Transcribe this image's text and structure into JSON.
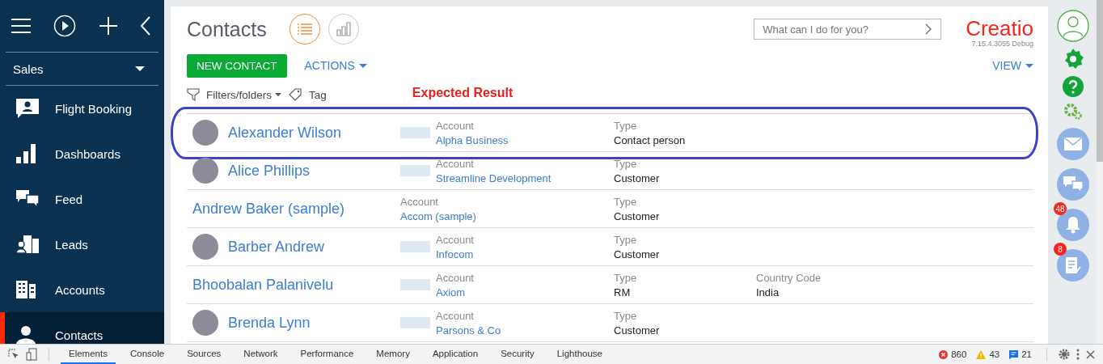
{
  "sidebar": {
    "section": "Sales",
    "items": [
      {
        "label": "Flight Booking",
        "kind": "booking",
        "selected": false
      },
      {
        "label": "Dashboards",
        "kind": "chart",
        "selected": false
      },
      {
        "label": "Feed",
        "kind": "feed",
        "selected": false
      },
      {
        "label": "Leads",
        "kind": "leads",
        "selected": false
      },
      {
        "label": "Accounts",
        "kind": "accounts",
        "selected": false
      },
      {
        "label": "Contacts",
        "kind": "contact",
        "selected": true
      }
    ]
  },
  "header": {
    "title": "Contacts",
    "views": [
      {
        "kind": "list",
        "selected": true
      },
      {
        "kind": "analytics",
        "selected": false
      }
    ],
    "search": {
      "placeholder": "What can I do for you?"
    },
    "logo": "Creatio",
    "version": "7.15.4.3055 Debug"
  },
  "toolbar": {
    "new_button": "NEW CONTACT",
    "actions": "ACTIONS",
    "view": "VIEW",
    "filters": "Filters/folders",
    "tag": "Tag"
  },
  "annotation": {
    "label": "Expected Result"
  },
  "contacts": [
    {
      "name": "Alexander Wilson",
      "avatar": true,
      "logo": true,
      "highlighted": true,
      "fields": [
        {
          "label": "Account",
          "value": "Alpha Business",
          "kind": "link"
        },
        {
          "label": "Type",
          "value": "Contact person",
          "kind": "text"
        }
      ]
    },
    {
      "name": "Alice Phillips",
      "avatar": true,
      "logo": true,
      "highlighted": false,
      "fields": [
        {
          "label": "Account",
          "value": "Streamline Development",
          "kind": "link"
        },
        {
          "label": "Type",
          "value": "Customer",
          "kind": "text"
        }
      ]
    },
    {
      "name": "Andrew Baker (sample)",
      "avatar": false,
      "logo": false,
      "highlighted": false,
      "fields": [
        {
          "label": "Account",
          "value": "Accom (sample)",
          "kind": "link"
        },
        {
          "label": "Type",
          "value": "Customer",
          "kind": "text"
        }
      ]
    },
    {
      "name": "Barber Andrew",
      "avatar": true,
      "logo": true,
      "highlighted": false,
      "fields": [
        {
          "label": "Account",
          "value": "Infocom",
          "kind": "link"
        },
        {
          "label": "Type",
          "value": "Customer",
          "kind": "text"
        }
      ]
    },
    {
      "name": "Bhoobalan Palanivelu",
      "avatar": false,
      "logo": true,
      "highlighted": false,
      "fields": [
        {
          "label": "Account",
          "value": "Axiom",
          "kind": "link"
        },
        {
          "label": "Type",
          "value": "RM",
          "kind": "text"
        },
        {
          "label": "Country Code",
          "value": "India",
          "kind": "text"
        }
      ]
    },
    {
      "name": "Brenda Lynn",
      "avatar": true,
      "logo": true,
      "highlighted": false,
      "fields": [
        {
          "label": "Account",
          "value": "Parsons & Co",
          "kind": "link"
        },
        {
          "label": "Type",
          "value": "Customer",
          "kind": "text"
        }
      ]
    }
  ],
  "right_bar": [
    {
      "kind": "profile"
    },
    {
      "kind": "settings"
    },
    {
      "kind": "help"
    },
    {
      "kind": "gears"
    },
    {
      "kind": "mail"
    },
    {
      "kind": "chat"
    },
    {
      "kind": "bell",
      "badge": "48"
    },
    {
      "kind": "tasks",
      "badge": "8"
    }
  ],
  "devtools": {
    "tabs": [
      {
        "label": "Elements",
        "selected": true
      },
      {
        "label": "Console",
        "selected": false
      },
      {
        "label": "Sources",
        "selected": false
      },
      {
        "label": "Network",
        "selected": false
      },
      {
        "label": "Performance",
        "selected": false
      },
      {
        "label": "Memory",
        "selected": false
      },
      {
        "label": "Application",
        "selected": false
      },
      {
        "label": "Security",
        "selected": false
      },
      {
        "label": "Lighthouse",
        "selected": false
      }
    ],
    "errors": "860",
    "warnings": "43",
    "messages": "21"
  }
}
